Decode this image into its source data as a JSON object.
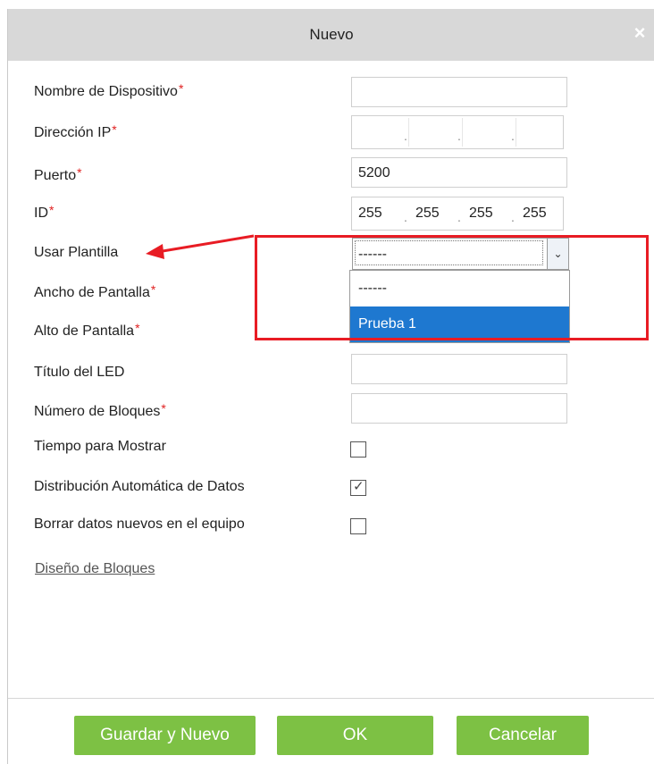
{
  "dialog": {
    "title": "Nuevo",
    "close_icon": "×"
  },
  "fields": {
    "device_name": {
      "label": "Nombre de Dispositivo",
      "required_mark": "*",
      "value": ""
    },
    "ip_address": {
      "label": "Dirección IP",
      "required_mark": "*",
      "octets": [
        "",
        "",
        "",
        ""
      ]
    },
    "port": {
      "label": "Puerto",
      "required_mark": "*",
      "value": "5200"
    },
    "id": {
      "label": "ID",
      "required_mark": "*",
      "octets": [
        "255",
        "255",
        "255",
        "255"
      ]
    },
    "template": {
      "label": "Usar Plantilla",
      "selected": "------",
      "options": [
        "------",
        "Prueba 1"
      ],
      "highlighted_option": "Prueba 1"
    },
    "screen_width": {
      "label": "Ancho de Pantalla",
      "required_mark": "*"
    },
    "screen_height": {
      "label": "Alto de Pantalla",
      "required_mark": "*"
    },
    "led_title": {
      "label": "Título del LED",
      "value": ""
    },
    "block_count": {
      "label": "Número de Bloques",
      "required_mark": "*",
      "value": ""
    },
    "show_time": {
      "label": "Tiempo para Mostrar",
      "checked": false
    },
    "auto_distribution": {
      "label": "Distribución Automática de Datos",
      "checked": true,
      "mark": "✓"
    },
    "delete_new_data": {
      "label": "Borrar datos nuevos en el equipo",
      "checked": false
    }
  },
  "block_design_link": "Diseño de Bloques",
  "buttons": {
    "save_new": "Guardar y Nuevo",
    "ok": "OK",
    "cancel": "Cancelar"
  },
  "colors": {
    "button_green": "#7dc144",
    "highlight_blue": "#1e78d0",
    "annotation_red": "#e81c24",
    "required_red": "#e02020"
  }
}
